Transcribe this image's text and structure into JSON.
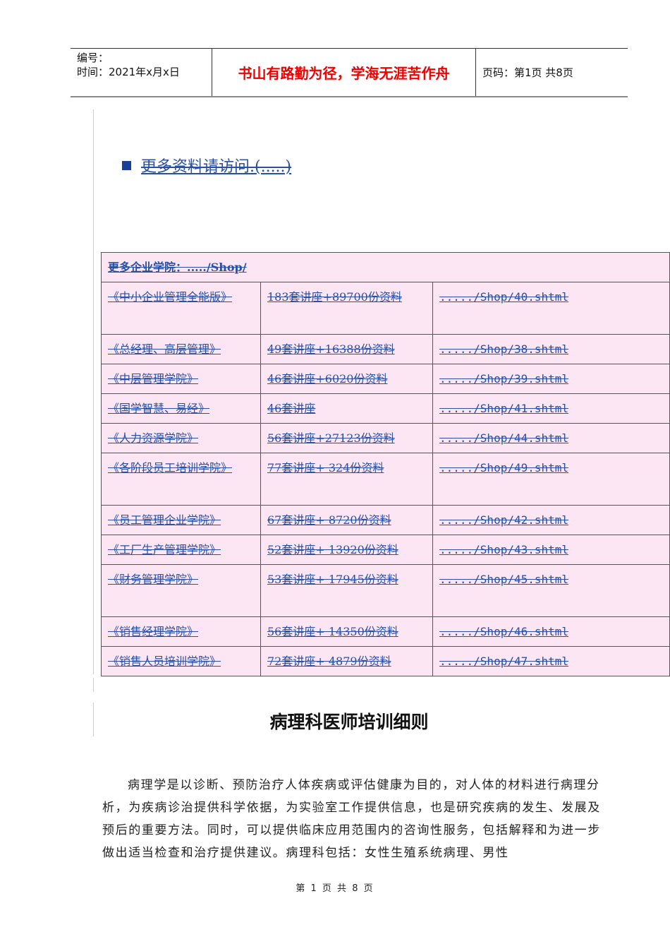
{
  "header": {
    "number_label": "编号：",
    "time_label": "时间：2021年x月x日",
    "motto": "书山有路勤为径，学海无涯苦作舟",
    "page_info": "页码：第1页  共8页"
  },
  "more_link": "更多资料请访问.(.....)",
  "table": {
    "header": "更多企业学院：...../Shop/",
    "rows": [
      {
        "name": "《中小企业管理全能版》",
        "desc": "183套讲座+89700份资料",
        "url": "...../Shop/40.shtml",
        "tall": true
      },
      {
        "name": "《总经理、高层管理》",
        "desc": "49套讲座+16388份资料",
        "url": "...../Shop/38.shtml"
      },
      {
        "name": "《中层管理学院》",
        "desc": "46套讲座+6020份资料",
        "url": "...../Shop/39.shtml"
      },
      {
        "name": "《国学智慧、易经》",
        "desc": "46套讲座",
        "url": "...../Shop/41.shtml"
      },
      {
        "name": "《人力资源学院》",
        "desc": "56套讲座+27123份资料",
        "url": "...../Shop/44.shtml"
      },
      {
        "name": "《各阶段员工培训学院》",
        "desc": "77套讲座+ 324份资料",
        "url": "...../Shop/49.shtml",
        "tall": true
      },
      {
        "name": "《员工管理企业学院》",
        "desc": "67套讲座+ 8720份资料",
        "url": "...../Shop/42.shtml"
      },
      {
        "name": "《工厂生产管理学院》",
        "desc": "52套讲座+ 13920份资料",
        "url": "...../Shop/43.shtml"
      },
      {
        "name": "《财务管理学院》",
        "desc": "53套讲座+ 17945份资料",
        "url": "...../Shop/45.shtml",
        "tall": true
      },
      {
        "name": "《销售经理学院》",
        "desc": "56套讲座+ 14350份资料",
        "url": "...../Shop/46.shtml"
      },
      {
        "name": "《销售人员培训学院》",
        "desc": "72套讲座+ 4879份资料",
        "url": "...../Shop/47.shtml"
      }
    ]
  },
  "doc_title": "病理科医师培训细则",
  "body_text": "病理学是以诊断、预防治疗人体疾病或评估健康为目的，对人体的材料进行病理分析，为疾病诊治提供科学依据，为实验室工作提供信息，也是研究疾病的发生、发展及预后的重要方法。同时，可以提供临床应用范围内的咨询性服务，包括解释和为进一步做出适当检查和治疗提供建议。病理科包括：女性生殖系统病理、男性",
  "footer": "第 1 页 共 8 页"
}
